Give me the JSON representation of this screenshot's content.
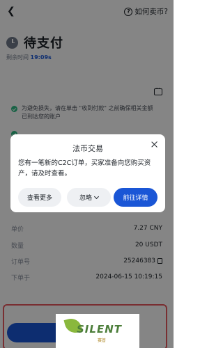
{
  "header": {
    "help_label": "如何卖币?"
  },
  "status": {
    "title": "待支付",
    "timer_label": "剩余时间",
    "timer_value": "19:09s"
  },
  "notices": [
    "为避免损失，请在单击 \"收到付款\" 之前确保相关金额",
    "已到达您的账户"
  ],
  "details": [
    {
      "key": "单价",
      "value": "7.27 CNY"
    },
    {
      "key": "数量",
      "value": "20 USDT"
    },
    {
      "key": "订单号",
      "value": "25246383"
    },
    {
      "key": "下单于",
      "value": "2024-06-15 10:19:15"
    }
  ],
  "modal": {
    "title": "法币交易",
    "body": "您有一笔新的C2C订单，买家准备向您购买资产，请及时查看。",
    "btn_more": "查看更多",
    "btn_ignore": "忽略",
    "btn_detail": "前往详情"
  },
  "watermark": {
    "text": "SILENT",
    "sub": "赛普"
  },
  "colors": {
    "accent": "#1a56d6",
    "success": "#2ebd85",
    "highlight_border": "#e8585f"
  }
}
